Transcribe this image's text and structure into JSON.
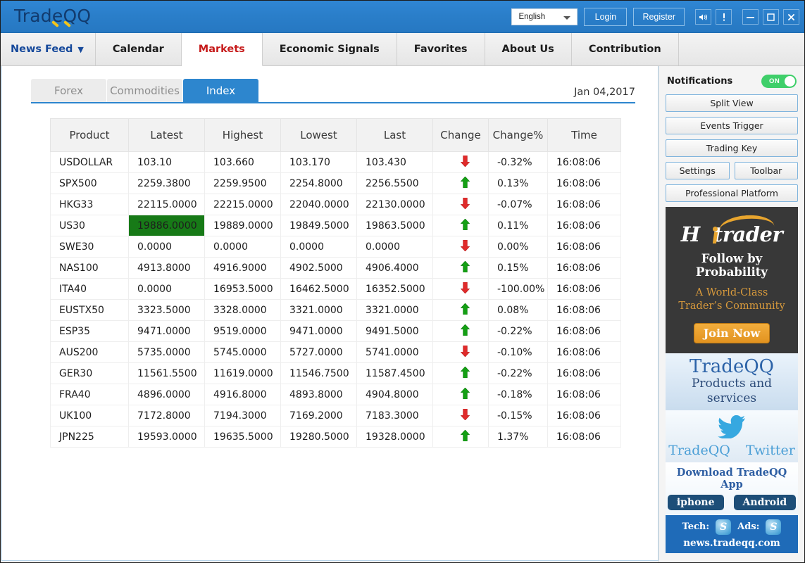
{
  "titlebar": {
    "app_name": "TradeQQ",
    "language": "English",
    "login_label": "Login",
    "register_label": "Register",
    "sound_icon": "speaker-icon",
    "alert_icon": "exclamation-icon",
    "minimize_icon": "minimize-icon",
    "maximize_icon": "maximize-icon",
    "close_icon": "close-icon",
    "bar_color": "#2a7ec9"
  },
  "mainnav": {
    "items": [
      {
        "label": "News Feed",
        "has_caret": true,
        "active": false
      },
      {
        "label": "Calendar",
        "has_caret": false,
        "active": false
      },
      {
        "label": "Markets",
        "has_caret": false,
        "active": true
      },
      {
        "label": "Economic Signals",
        "has_caret": false,
        "active": false
      },
      {
        "label": "Favorites",
        "has_caret": false,
        "active": false
      },
      {
        "label": "About Us",
        "has_caret": false,
        "active": false
      },
      {
        "label": "Contribution",
        "has_caret": false,
        "active": false
      }
    ],
    "active_color": "#c61a1a",
    "newsfeed_color": "#16499b"
  },
  "subtabs": {
    "items": [
      {
        "label": "Forex",
        "active": false
      },
      {
        "label": "Commodities",
        "active": false
      },
      {
        "label": "Index",
        "active": true
      }
    ],
    "date": "Jan 04,2017",
    "active_color": "#2d86ce"
  },
  "table": {
    "columns": [
      "Product",
      "Latest",
      "Highest",
      "Lowest",
      "Last",
      "Change",
      "Change%",
      "Time"
    ],
    "rows": [
      {
        "product": "USDOLLAR",
        "latest": "103.10",
        "latest_style": "plain",
        "highest": "103.660",
        "lowest": "103.170",
        "last": "103.430",
        "change": "down",
        "pct": "-0.32%",
        "pct_style": "plain",
        "time": "16:08:06"
      },
      {
        "product": "SPX500",
        "latest": "2259.3800",
        "latest_style": "up",
        "highest": "2259.9500",
        "lowest": "2254.8000",
        "last": "2256.5500",
        "change": "up",
        "pct": "0.13%",
        "pct_style": "up",
        "time": "16:08:06"
      },
      {
        "product": "HKG33",
        "latest": "22115.0000",
        "latest_style": "plain",
        "highest": "22215.0000",
        "lowest": "22040.0000",
        "last": "22130.0000",
        "change": "down",
        "pct": "-0.07%",
        "pct_style": "plain",
        "time": "16:08:06"
      },
      {
        "product": "US30",
        "latest": "19886.0000",
        "latest_style": "highlight",
        "highest": "19889.0000",
        "lowest": "19849.5000",
        "last": "19863.5000",
        "change": "up",
        "pct": "0.11%",
        "pct_style": "plain",
        "time": "16:08:06"
      },
      {
        "product": "SWE30",
        "latest": "0.0000",
        "latest_style": "plain",
        "highest": "0.0000",
        "lowest": "0.0000",
        "last": "0.0000",
        "change": "down",
        "pct": "0.00%",
        "pct_style": "plain",
        "time": "16:08:06"
      },
      {
        "product": "NAS100",
        "latest": "4913.8000",
        "latest_style": "up",
        "highest": "4916.9000",
        "lowest": "4902.5000",
        "last": "4906.4000",
        "change": "up",
        "pct": "0.15%",
        "pct_style": "up",
        "time": "16:08:06"
      },
      {
        "product": "ITA40",
        "latest": "0.0000",
        "latest_style": "plain",
        "highest": "16953.5000",
        "lowest": "16462.5000",
        "last": "16352.5000",
        "change": "down",
        "pct": "-100.00%",
        "pct_style": "plain",
        "time": "16:08:06"
      },
      {
        "product": "EUSTX50",
        "latest": "3323.5000",
        "latest_style": "plain",
        "highest": "3328.0000",
        "lowest": "3321.0000",
        "last": "3321.0000",
        "change": "up",
        "pct": "0.08%",
        "pct_style": "plain",
        "time": "16:08:06"
      },
      {
        "product": "ESP35",
        "latest": "9471.0000",
        "latest_style": "down",
        "highest": "9519.0000",
        "lowest": "9471.0000",
        "last": "9491.5000",
        "change": "up",
        "pct": "-0.22%",
        "pct_style": "down",
        "time": "16:08:06"
      },
      {
        "product": "AUS200",
        "latest": "5735.0000",
        "latest_style": "plain",
        "highest": "5745.0000",
        "lowest": "5727.0000",
        "last": "5741.0000",
        "change": "down",
        "pct": "-0.10%",
        "pct_style": "plain",
        "time": "16:08:06"
      },
      {
        "product": "GER30",
        "latest": "11561.5500",
        "latest_style": "down",
        "highest": "11619.0000",
        "lowest": "11546.7500",
        "last": "11587.4500",
        "change": "up",
        "pct": "-0.22%",
        "pct_style": "down",
        "time": "16:08:06"
      },
      {
        "product": "FRA40",
        "latest": "4896.0000",
        "latest_style": "down",
        "highest": "4916.8000",
        "lowest": "4893.8000",
        "last": "4904.8000",
        "change": "up",
        "pct": "-0.18%",
        "pct_style": "down",
        "time": "16:08:06"
      },
      {
        "product": "UK100",
        "latest": "7172.8000",
        "latest_style": "down",
        "highest": "7194.3000",
        "lowest": "7169.2000",
        "last": "7183.3000",
        "change": "down",
        "pct": "-0.15%",
        "pct_style": "down",
        "time": "16:08:06"
      },
      {
        "product": "JPN225",
        "latest": "19593.0000",
        "latest_style": "plain",
        "highest": "19635.5000",
        "lowest": "19280.5000",
        "last": "19328.0000",
        "change": "up",
        "pct": "1.37%",
        "pct_style": "plain",
        "time": "16:08:06"
      }
    ],
    "up_color": "#169016",
    "down_color": "#e02b2b",
    "symbol_color": "#3a8ed0",
    "highlight_bg": "#177a17"
  },
  "sidebar": {
    "notifications_label": "Notifications",
    "toggle_state": "ON",
    "toggle_color": "#3fcf6a",
    "buttons": [
      {
        "label": "Split View"
      },
      {
        "label": "Events Trigger"
      },
      {
        "label": "Trading Key"
      }
    ],
    "button_pair": [
      {
        "label": "Settings"
      },
      {
        "label": "Toolbar"
      }
    ],
    "wide_button": {
      "label": "Professional Platform"
    },
    "ad_hitrader": {
      "logo_hi": "H",
      "logo_trader": "trader",
      "tagline": "Follow by Probability",
      "sub1": "A World-Class",
      "sub2": "Trader’s Community",
      "cta": "Join Now",
      "bg_color": "#383838",
      "accent_color": "#e8a52e"
    },
    "ad_products": {
      "title": "TradeQQ",
      "subtitle": "Products and services"
    },
    "ad_twitter": {
      "bird_icon": "twitter-bird-icon",
      "left_label": "TradeQQ",
      "right_label": "Twitter"
    },
    "ad_download": {
      "title": "Download TradeQQ App",
      "iphone_label": "iphone",
      "android_label": "Android"
    },
    "ad_contact": {
      "tech_label": "Tech:",
      "ads_label": "Ads:",
      "skype_icon": "skype-icon",
      "website": "news.tradeqq.com",
      "bg_color": "#1f6bb8"
    }
  }
}
